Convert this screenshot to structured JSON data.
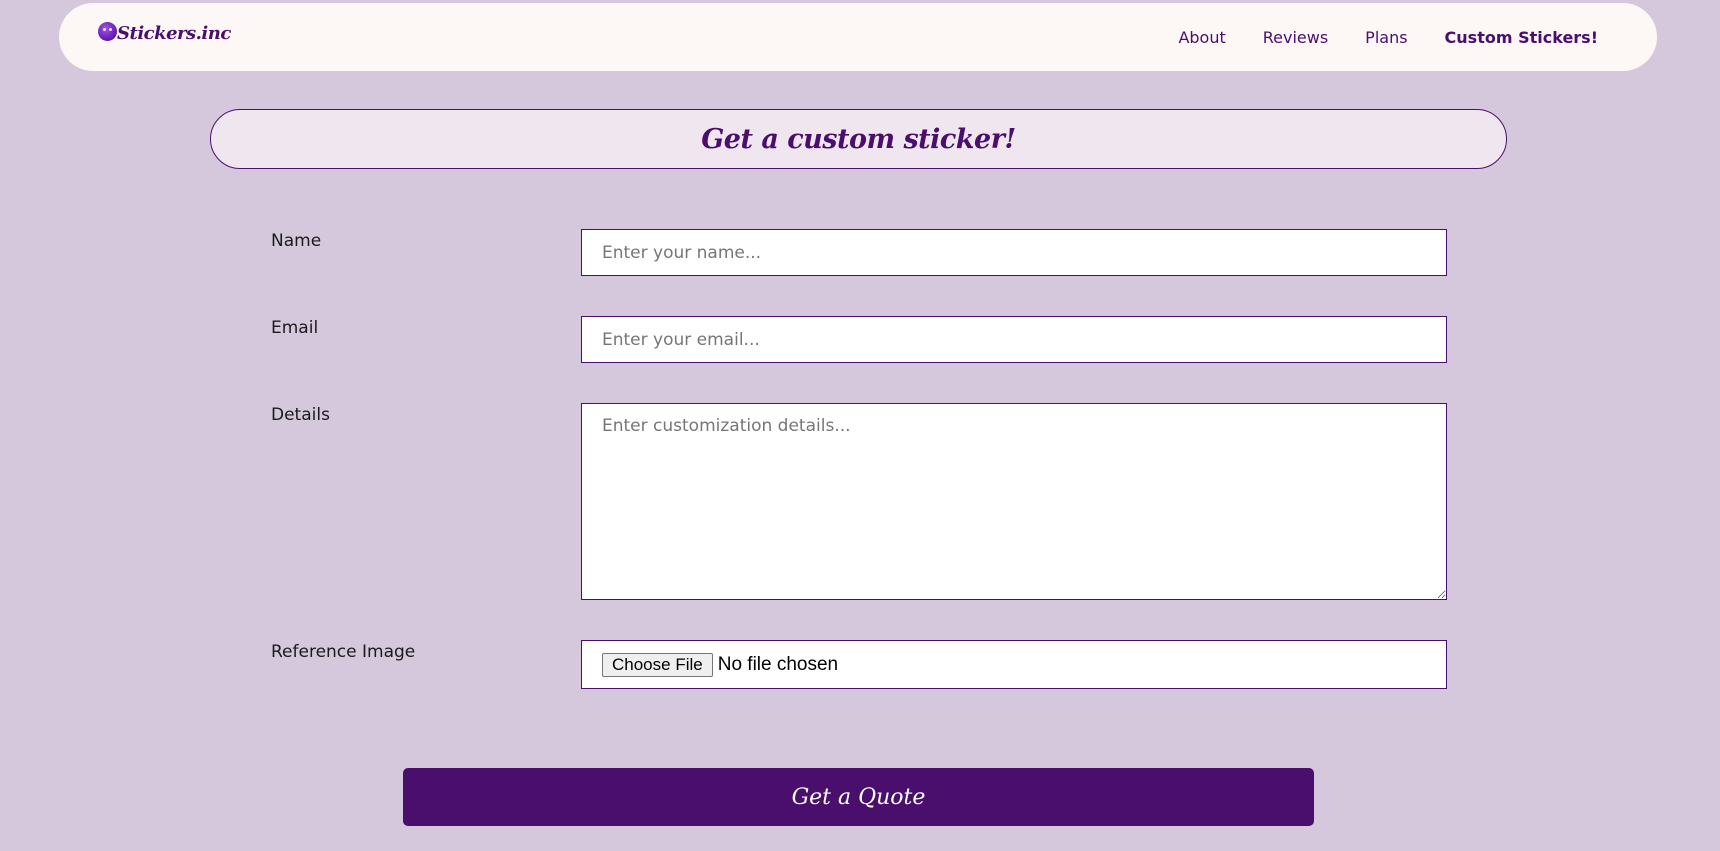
{
  "brand": {
    "name": "Stickers.inc",
    "logo_icon": "smiley-sticker-icon"
  },
  "nav": {
    "items": [
      {
        "label": "About"
      },
      {
        "label": "Reviews"
      },
      {
        "label": "Plans"
      },
      {
        "label": "Custom Stickers!"
      }
    ]
  },
  "page": {
    "title": "Get a custom sticker!"
  },
  "form": {
    "name": {
      "label": "Name",
      "placeholder": "Enter your name...",
      "value": ""
    },
    "email": {
      "label": "Email",
      "placeholder": "Enter your email...",
      "value": ""
    },
    "details": {
      "label": "Details",
      "placeholder": "Enter customization details...",
      "value": ""
    },
    "reference": {
      "label": "Reference Image",
      "button_label": "Choose File",
      "status": "No file chosen"
    },
    "submit_label": "Get a Quote"
  },
  "colors": {
    "background": "#d5c8dd",
    "navbar": "#fdf7f6",
    "accent": "#4a0f6d",
    "title_bar": "#f0e6ef"
  }
}
